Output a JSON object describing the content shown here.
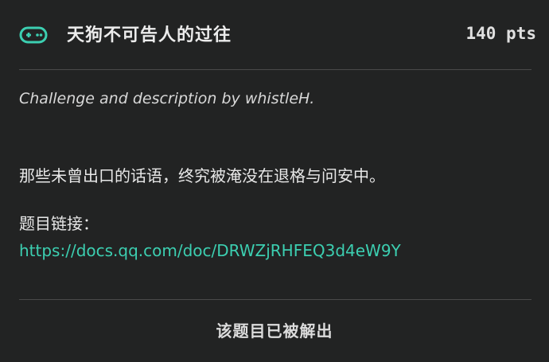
{
  "challenge": {
    "icon": "gamepad-icon",
    "accent_color": "#3ccfb1",
    "title": "天狗不可告人的过往",
    "points": "140 pts",
    "byline": "Challenge and description by whistleH.",
    "description": "那些未曾出口的话语，终究被淹没在退格与问安中。",
    "link_label": "题目链接：",
    "link_url": "https://docs.qq.com/doc/DRWZjRHFEQ3d4eW9Y",
    "status": "该题目已被解出"
  }
}
